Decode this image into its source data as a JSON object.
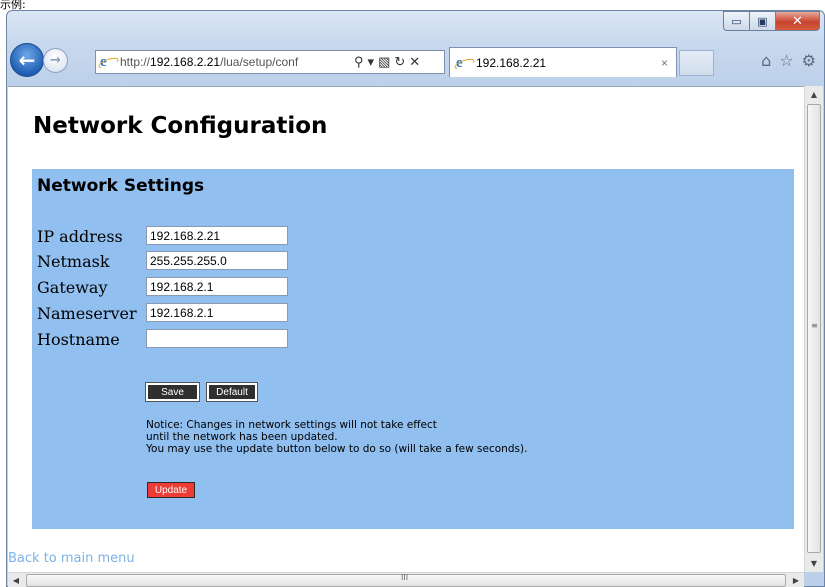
{
  "top_fragment": "示例:",
  "browser": {
    "url_prefix": "http://",
    "url_host": "192.168.2.21",
    "url_rest": "/lua/setup/conf",
    "tab_title": "192.168.2.21",
    "tab_close": "×",
    "min_glyph": "▭",
    "max_glyph": "▣",
    "close_glyph": "✕",
    "back_glyph": "←",
    "fwd_glyph": "→",
    "search_glyph": "⚲",
    "dropdown_glyph": "▾",
    "compat_glyph": "▧",
    "refresh_glyph": "↻",
    "stop_glyph": "✕",
    "home_glyph": "⌂",
    "favorites_glyph": "☆",
    "tools_glyph": "⚙"
  },
  "page": {
    "title": "Network Configuration",
    "section_title": "Network Settings",
    "fields": [
      {
        "label": "IP address",
        "value": "192.168.2.21"
      },
      {
        "label": "Netmask",
        "value": "255.255.255.0"
      },
      {
        "label": "Gateway",
        "value": "192.168.2.1"
      },
      {
        "label": "Nameserver",
        "value": "192.168.2.1"
      },
      {
        "label": "Hostname",
        "value": ""
      }
    ],
    "save_label": "Save",
    "default_label": "Default",
    "notice_lines": [
      "Notice: Changes in network settings will not take effect",
      "until the network has been updated.",
      "You may use the update button below to do so (will take a few seconds)."
    ],
    "update_label": "Update",
    "back_link": "Back to main menu"
  },
  "scrollbars": {
    "up": "▲",
    "down": "▼",
    "left": "◀",
    "right": "▶",
    "v_grip": "≡",
    "h_grip": "III"
  }
}
